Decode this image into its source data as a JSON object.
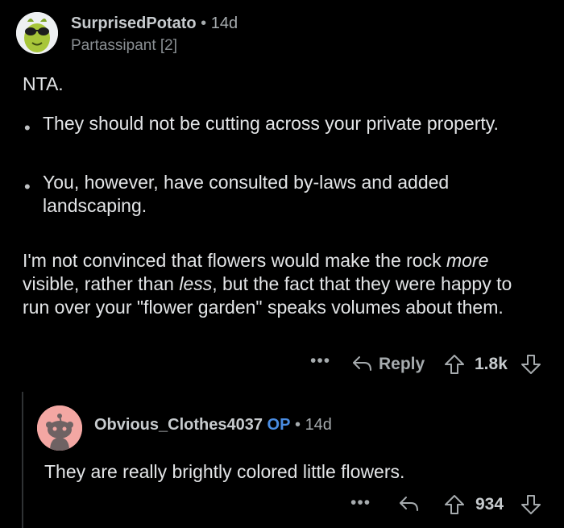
{
  "comment": {
    "username": "SurprisedPotato",
    "separator": " • ",
    "age": "14d",
    "flair": "Partassipant [2]",
    "verdict": "NTA.",
    "bullets": [
      "They should not be cutting across your private property.",
      "You, however, have consulted by-laws and added landscaping."
    ],
    "paragraph": {
      "p1": "I'm not convinced that flowers would make the rock ",
      "em1": "more",
      "p2": " visible, rather than ",
      "em2": "less",
      "p3": ", but the fact that they were happy to run over your \"flower garden\" speaks volumes about them."
    },
    "actions": {
      "more": "•••",
      "reply_label": "Reply",
      "score": "1.8k"
    }
  },
  "reply": {
    "username": "Obvious_Clothes4037",
    "op_badge": "OP",
    "separator": " • ",
    "age": "14d",
    "text": "They are really brightly colored little flowers.",
    "actions": {
      "more": "•••",
      "score": "934"
    }
  },
  "colors": {
    "background": "#000000",
    "op_badge": "#4a8de3",
    "avatar2_bg": "#f3a7a3"
  }
}
